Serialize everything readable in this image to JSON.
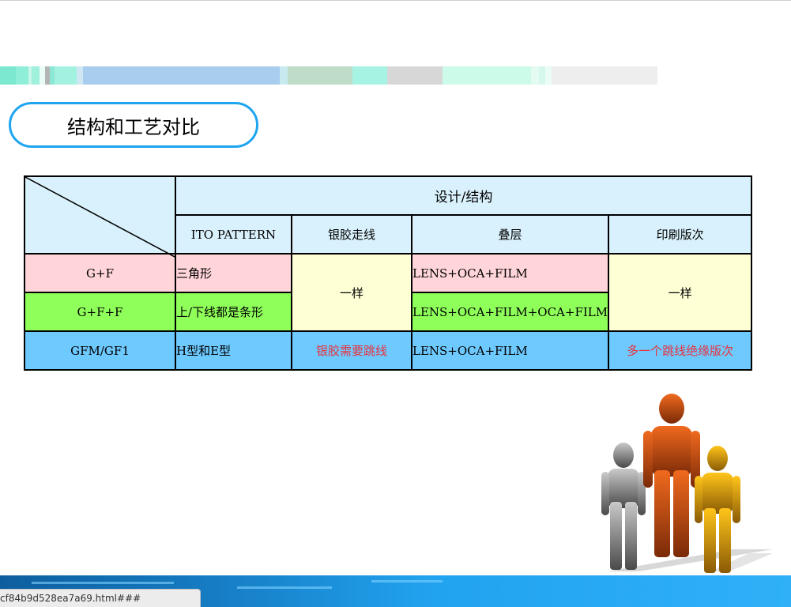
{
  "title": "结构和工艺对比",
  "table": {
    "group_header": "设计/结构",
    "columns": [
      "ITO PATTERN",
      "银胶走线",
      "叠层",
      "印刷版次"
    ],
    "rows": [
      {
        "name": "G+F",
        "ito": "三角形",
        "stack": "LENS+OCA+FILM"
      },
      {
        "name": "G+F+F",
        "ito": "上/下线都是条形",
        "stack": "LENS+OCA+FILM+OCA+FILM"
      },
      {
        "name": "GFM/GF1",
        "ito": "H型和E型",
        "silver": "银胶需要跳线",
        "stack": "LENS+OCA+FILM",
        "print": "多一个跳线绝缘版次"
      }
    ],
    "merged_silver": "一样",
    "merged_print": "一样"
  },
  "status_url": "cf84b9d528ea7a69.html###",
  "colors": {
    "title_border": "#1ea5f0",
    "header_bg": "#d9f1fc",
    "row1_bg": "#ffd5d9",
    "row2_bg": "#8fff5a",
    "row3_bg": "#6ec9ff",
    "merged_bg": "#ffffd6",
    "highlight_text": "#e8323c"
  },
  "decoration": {
    "figures": "three-people-figures"
  }
}
